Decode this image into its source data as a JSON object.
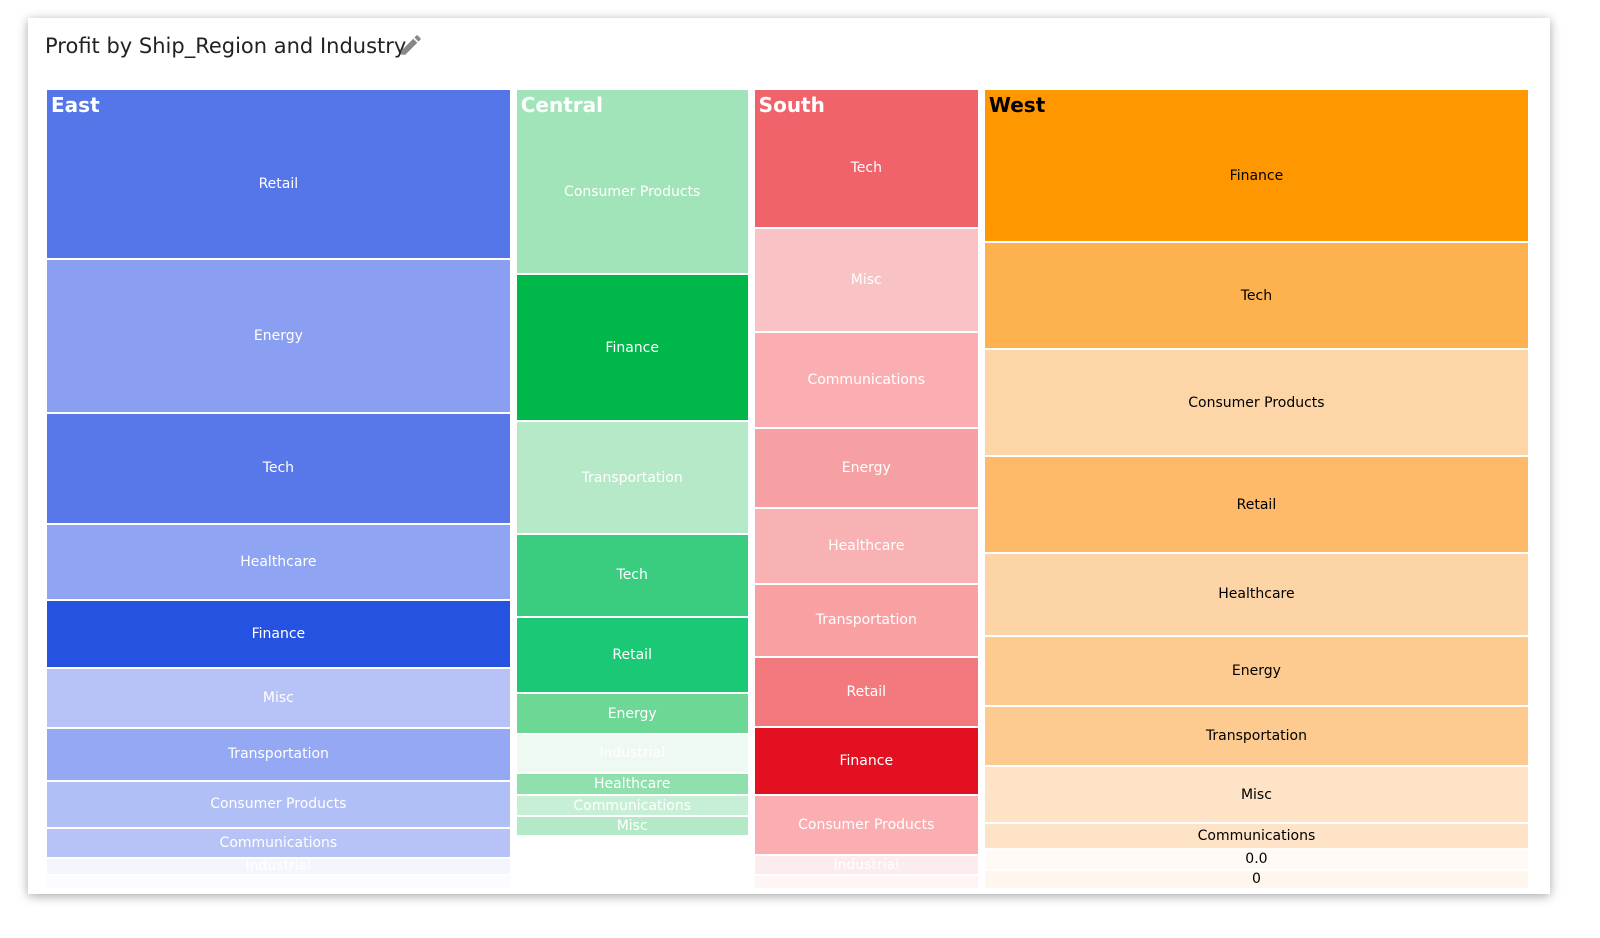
{
  "title": "Profit by Ship_Region and Industry",
  "edit_icon": "pencil-icon",
  "chart_data": {
    "type": "treemap",
    "title": "Profit by Ship_Region and Industry",
    "regions": [
      {
        "name": "East",
        "header_color": "#ffffff",
        "text_color": "#ffffff",
        "items": [
          {
            "label": "Retail",
            "value": 77.8,
            "color": "#5476e8"
          },
          {
            "label": "Energy",
            "value": 70.4,
            "color": "#8a9ff2"
          },
          {
            "label": "Tech",
            "value": 50.9,
            "color": "#5878e9"
          },
          {
            "label": "Healthcare",
            "value": 34.7,
            "color": "#8fa4f2"
          },
          {
            "label": "Finance",
            "value": 31.5,
            "color": "#2552e0"
          },
          {
            "label": "Misc",
            "value": 27.3,
            "color": "#b7c3f6"
          },
          {
            "label": "Transportation",
            "value": 24.1,
            "color": "#94a8f3"
          },
          {
            "label": "Consumer Products",
            "value": 21.8,
            "color": "#b0bff6"
          },
          {
            "label": "Communications",
            "value": 13.4,
            "color": "#b7c3f6"
          },
          {
            "label": "Industrial",
            "value": 7.9,
            "color": "#f4f6fe"
          },
          {
            "label": "",
            "value": 6.5,
            "color": "#fbfcff"
          }
        ]
      },
      {
        "name": "Central",
        "header_color": "#ffffff",
        "text_color": "#ffffff",
        "items": [
          {
            "label": "Consumer Products",
            "value": 42.3,
            "color": "#a2e4b9"
          },
          {
            "label": "Finance",
            "value": 33.6,
            "color": "#00b84a"
          },
          {
            "label": "Transportation",
            "value": 25.8,
            "color": "#b6e9c8"
          },
          {
            "label": "Tech",
            "value": 18.9,
            "color": "#3acd7f"
          },
          {
            "label": "Retail",
            "value": 17.5,
            "color": "#1ac875"
          },
          {
            "label": "Energy",
            "value": 9.2,
            "color": "#6dd796"
          },
          {
            "label": "Industrial",
            "value": 9.0,
            "color": "#eef9f2"
          },
          {
            "label": "Healthcare",
            "value": 5.1,
            "color": "#8fe0ad"
          },
          {
            "label": "Communications",
            "value": 4.8,
            "color": "#c6efd5"
          },
          {
            "label": "Misc",
            "value": 4.4,
            "color": "#b4e9c8"
          },
          {
            "label": "",
            "value": 12.2,
            "color": "#ffffff"
          }
        ]
      },
      {
        "name": "South",
        "header_color": "#ffffff",
        "text_color": "#ffffff",
        "items": [
          {
            "label": "Tech",
            "value": 30.6,
            "color": "#f0636a"
          },
          {
            "label": "Misc",
            "value": 23.0,
            "color": "#f9c3c6"
          },
          {
            "label": "Communications",
            "value": 21.2,
            "color": "#fbaeb1"
          },
          {
            "label": "Energy",
            "value": 17.8,
            "color": "#f7a0a3"
          },
          {
            "label": "Healthcare",
            "value": 16.7,
            "color": "#f9b2b4"
          },
          {
            "label": "Transportation",
            "value": 16.1,
            "color": "#f8a0a2"
          },
          {
            "label": "Retail",
            "value": 15.6,
            "color": "#f27a7e"
          },
          {
            "label": "Finance",
            "value": 14.9,
            "color": "#e31022"
          },
          {
            "label": "Consumer Products",
            "value": 13.2,
            "color": "#fbaeb2"
          },
          {
            "label": "Industrial",
            "value": 4.5,
            "color": "#fdecee"
          },
          {
            "label": "",
            "value": 3.1,
            "color": "#fff5f5"
          }
        ]
      },
      {
        "name": "West",
        "header_color": "#000000",
        "text_color": "#000000",
        "items": [
          {
            "label": "Finance",
            "value": 82.4,
            "color": "#fe9700"
          },
          {
            "label": "Tech",
            "value": 57.5,
            "color": "#feb24f"
          },
          {
            "label": "Consumer Products",
            "value": 57.5,
            "color": "#fdd5a7"
          },
          {
            "label": "Retail",
            "value": 52.0,
            "color": "#feba68"
          },
          {
            "label": "Healthcare",
            "value": 44.4,
            "color": "#fdd4a6"
          },
          {
            "label": "Energy",
            "value": 37.9,
            "color": "#fdca90"
          },
          {
            "label": "Transportation",
            "value": 32.0,
            "color": "#fdca8f"
          },
          {
            "label": "Misc",
            "value": 30.9,
            "color": "#fee3c6"
          },
          {
            "label": "Communications",
            "value": 13.6,
            "color": "#fee3c6"
          },
          {
            "label": "0.0",
            "value": 11.4,
            "color": "#fffaf6"
          },
          {
            "label": "0",
            "value": 10.3,
            "color": "#fff7ee"
          }
        ]
      }
    ]
  }
}
